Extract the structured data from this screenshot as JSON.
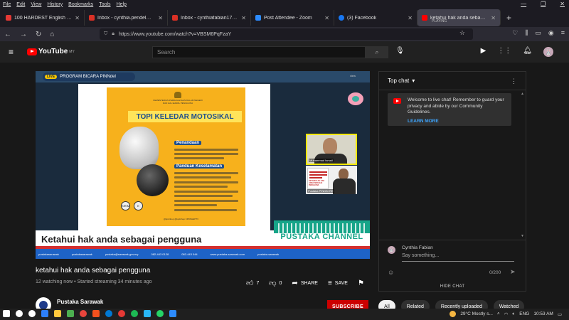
{
  "menubar": {
    "items": [
      "File",
      "Edit",
      "View",
      "History",
      "Bookmarks",
      "Tools",
      "Help"
    ]
  },
  "window_controls": [
    "—",
    "❐",
    "✕"
  ],
  "tabs": [
    {
      "label": "100 HARDEST English words p",
      "color": "#e53935"
    },
    {
      "label": "Inbox - cynthia.pendel@gmail.",
      "color": "#d93025"
    },
    {
      "label": "Inbox - cynthiafabian17@gmail",
      "color": "#d93025"
    },
    {
      "label": "Post Attendee - Zoom",
      "color": "#2d8cff"
    },
    {
      "label": "(3) Facebook",
      "color": "#1877f2"
    },
    {
      "label": "ketahui hak anda sebagai pengg",
      "color": "#ff0000",
      "status": "PLAYING"
    }
  ],
  "newtab_label": "+",
  "nav": {
    "url": "https://www.youtube.com/watch?v=VBSM6PqFzaY"
  },
  "youtube": {
    "logo_text": "YouTube",
    "region": "MY",
    "search_placeholder": "Search",
    "avatar_initial": "🐰"
  },
  "video": {
    "program_label": "PROGRAM BICARA PINNdel",
    "program_badge": "LIVE",
    "tiny_label": "view",
    "ministry": "KEMENTERIAN PERDAGANGAN DALAM NEGERI DAN HAL EHWAL PENGGUNA",
    "poster_title": "TOPI KELEDAR MOTOSIKAL",
    "section1": "Penandaan",
    "section2": "Panduan Keselamatan",
    "mark1": "SIRIM",
    "mark2": "E",
    "footer_handles": "@kpdnhep  @kpdnhep  KPDNHEPTV",
    "cam1_name": "Muhammad Ismail",
    "cam2_name": "Pustaka PINDBI RE",
    "cam2_title": "KETAHUILAH HAK ANDA SEBAGAI PENGGUNA",
    "headline": "Ketahui hak anda sebagai pengguna",
    "brand": "PUSTAKA CHANNEL",
    "ticker": [
      "pustakasarawak",
      "pustakasarawak",
      "pustaka@sarawak.gov.my",
      "082-443 0128",
      "082-443 044",
      "www.pustaka-sarawak.com",
      "pustaka.sarawak"
    ],
    "title": "ketahui hak anda sebagai pengguna",
    "meta": "12 watching now • Started streaming 34 minutes ago",
    "likes": "7",
    "dislikes": "0",
    "share": "SHARE",
    "save": "SAVE"
  },
  "channel": {
    "name": "Pustaka Sarawak",
    "subscribe": "SUBSCRIBE"
  },
  "chat": {
    "title": "Top chat",
    "welcome": "Welcome to live chat! Remember to guard your privacy and abide by our Community Guidelines.",
    "learn_more": "LEARN MORE",
    "user": "Cynthia Fabian",
    "input_placeholder": "Say something...",
    "count": "0/200",
    "hide": "HIDE CHAT"
  },
  "chips": [
    "All",
    "Related",
    "Recently uploaded",
    "Watched"
  ],
  "taskbar": {
    "weather": "29°C  Mostly s...",
    "lang": "ENG",
    "time": "10:53 AM",
    "icon_colors": [
      "#ffffff",
      "#ffffff",
      "#ffffff",
      "#2d7ff9",
      "#ffc83d",
      "#4caf50",
      "#e8453c",
      "#f4511e",
      "#0078d4",
      "#1db954",
      "#e53935",
      "#29b6f6",
      "#25d366",
      "#2d8cff"
    ]
  },
  "colors": {
    "yt_red": "#ff0000",
    "subscribe_red": "#cc0000",
    "link_blue": "#3ea6ff",
    "brand_green": "#17a589"
  }
}
